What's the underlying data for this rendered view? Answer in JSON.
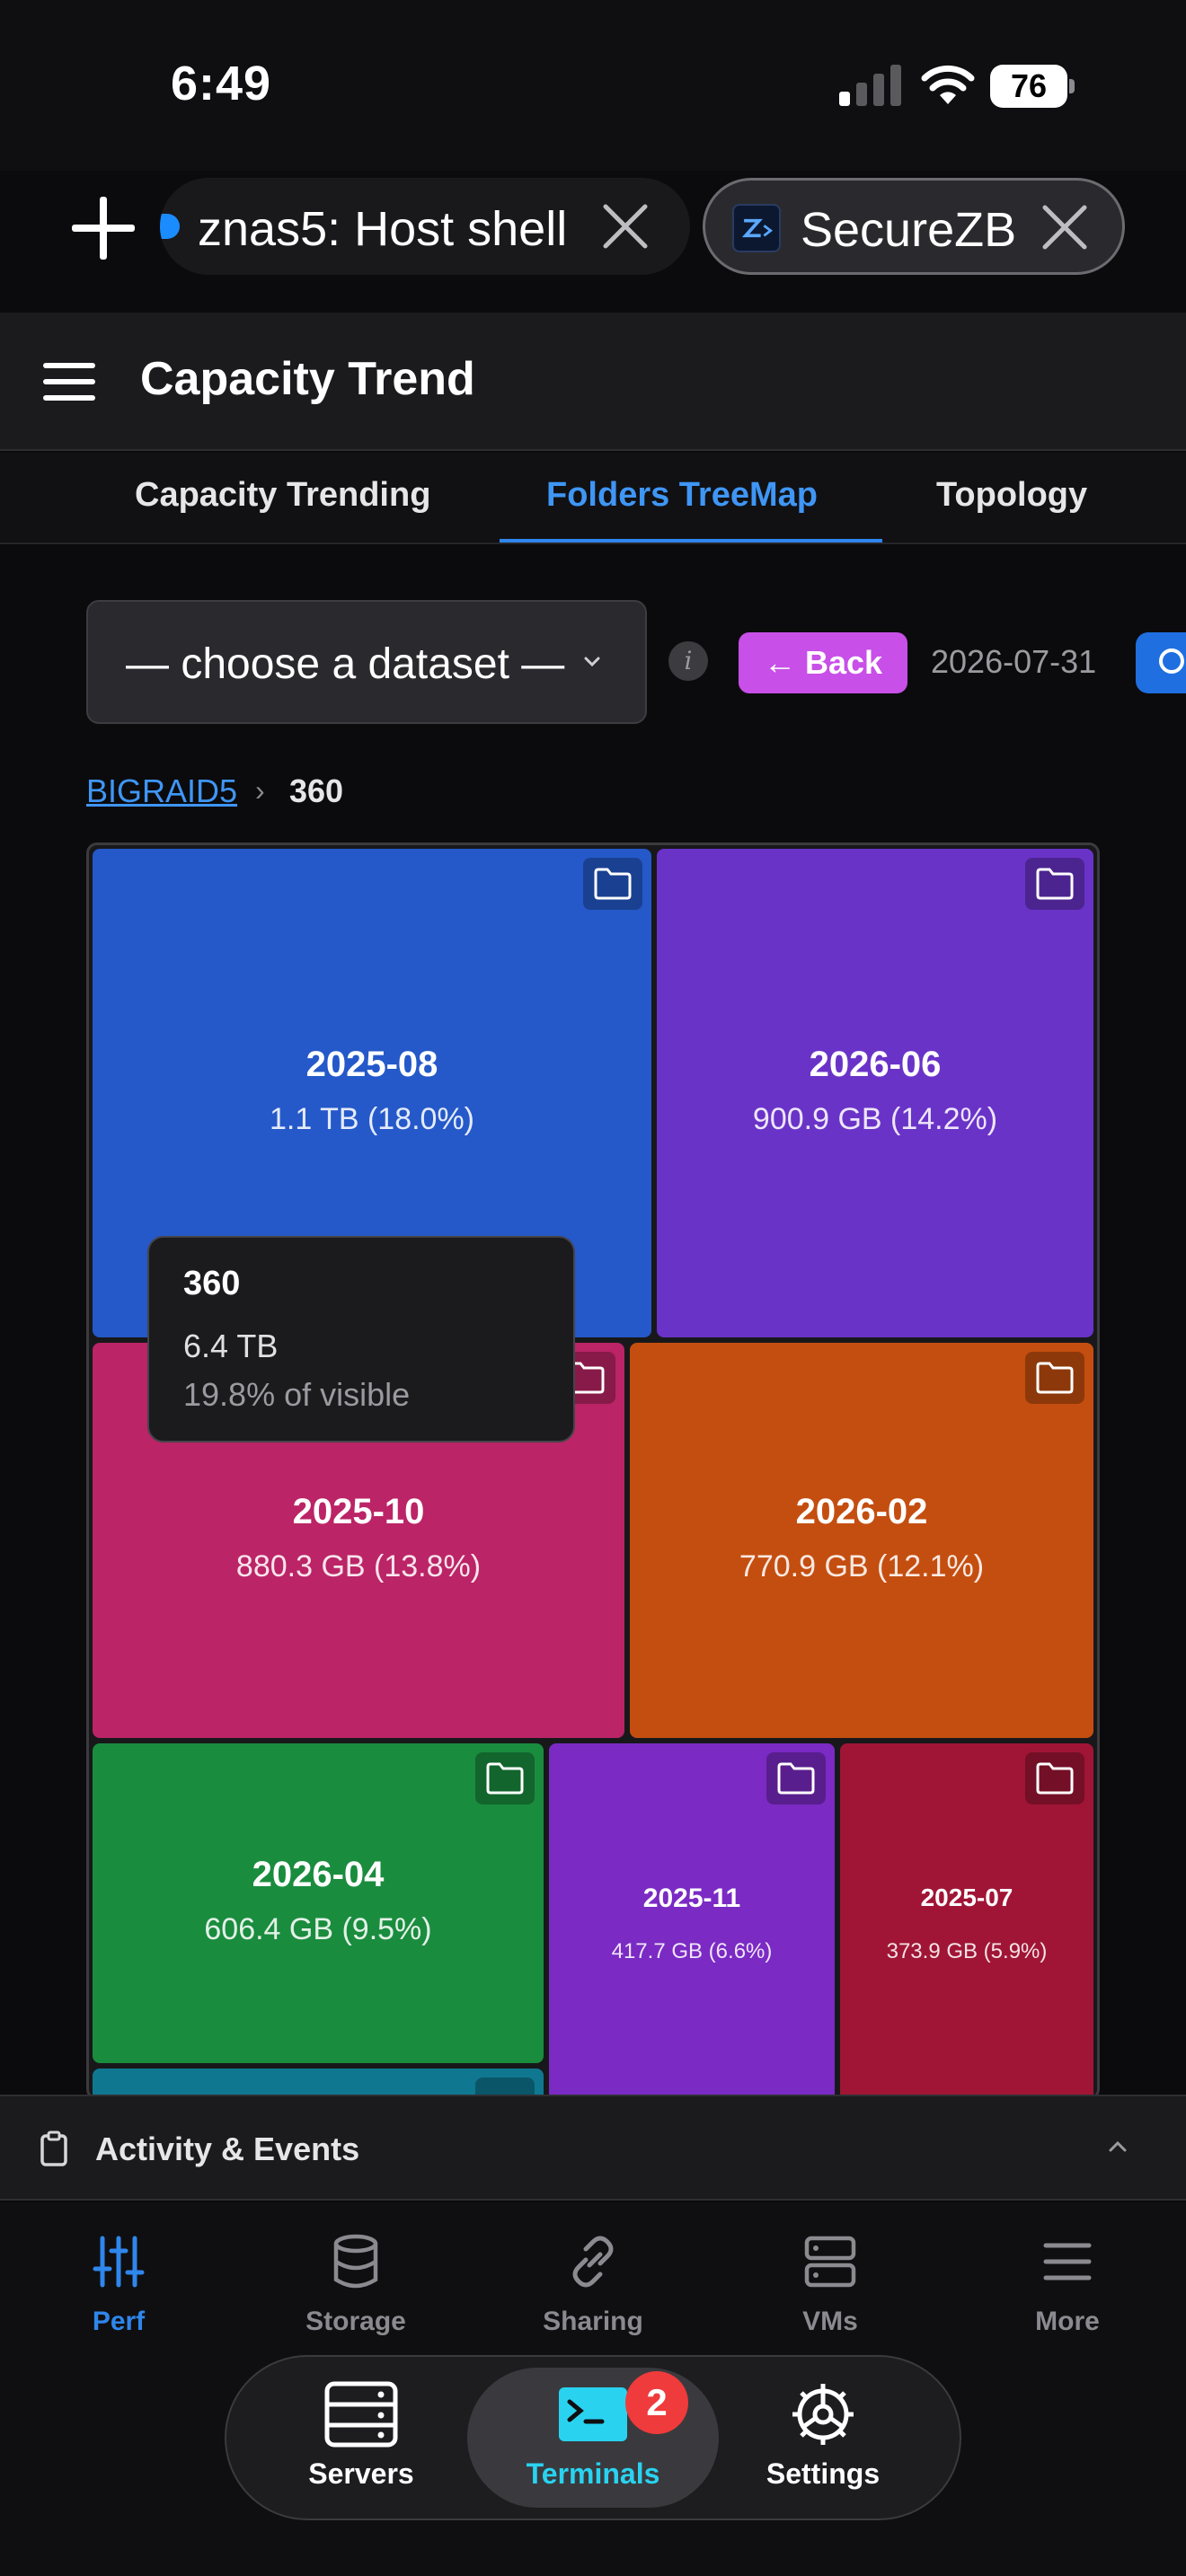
{
  "status_bar": {
    "time": "6:49",
    "battery": "76"
  },
  "browser_tabs": [
    {
      "label": "znas5: Host shell"
    },
    {
      "label": "SecureZB"
    }
  ],
  "header": {
    "title": "Capacity Trend"
  },
  "subtabs": [
    {
      "label": "Capacity Trending"
    },
    {
      "label": "Folders TreeMap",
      "active": true
    },
    {
      "label": "Topology"
    }
  ],
  "controls": {
    "dataset_placeholder": "— choose a dataset —",
    "info": "i",
    "back_label": "← Back",
    "date": "2026-07-31"
  },
  "breadcrumb": {
    "root": "BIGRAID5",
    "separator": "›",
    "current": "360"
  },
  "treemap": {
    "cells": [
      {
        "name": "2025-08",
        "size": "1.1 TB (18.0%)",
        "color": "#2559c9"
      },
      {
        "name": "2026-06",
        "size": "900.9 GB (14.2%)",
        "color": "#6a33c8"
      },
      {
        "name": "2025-10",
        "size": "880.3 GB (13.8%)",
        "color": "#bb2466"
      },
      {
        "name": "2026-02",
        "size": "770.9 GB (12.1%)",
        "color": "#c44e10"
      },
      {
        "name": "2026-04",
        "size": "606.4 GB (9.5%)",
        "color": "#1a8c3e"
      },
      {
        "name": "2025-11",
        "size": "417.7 GB (6.6%)",
        "color": "#7b2ac4"
      },
      {
        "name": "2025-07",
        "size": "373.9 GB (5.9%)",
        "color": "#a01535"
      },
      {
        "name": "",
        "size": "",
        "color": "#0f7890"
      }
    ]
  },
  "tooltip": {
    "title": "360",
    "size": "6.4 TB",
    "percent": "19.8% of visible"
  },
  "activity": {
    "label": "Activity & Events"
  },
  "bottom_nav": [
    {
      "label": "Perf",
      "icon": "sliders-icon",
      "active": true
    },
    {
      "label": "Storage",
      "icon": "database-icon"
    },
    {
      "label": "Sharing",
      "icon": "link-icon"
    },
    {
      "label": "VMs",
      "icon": "server-stack-icon"
    },
    {
      "label": "More",
      "icon": "menu-icon"
    }
  ],
  "dock": [
    {
      "label": "Servers",
      "icon": "servers-icon"
    },
    {
      "label": "Terminals",
      "icon": "terminal-icon",
      "active": true,
      "badge": "2"
    },
    {
      "label": "Settings",
      "icon": "gear-icon"
    }
  ],
  "colors": {
    "accent": "#2f86ec",
    "back_button": "#c84fe8",
    "terminal_accent": "#29d3f0",
    "badge": "#ef3b3b"
  }
}
